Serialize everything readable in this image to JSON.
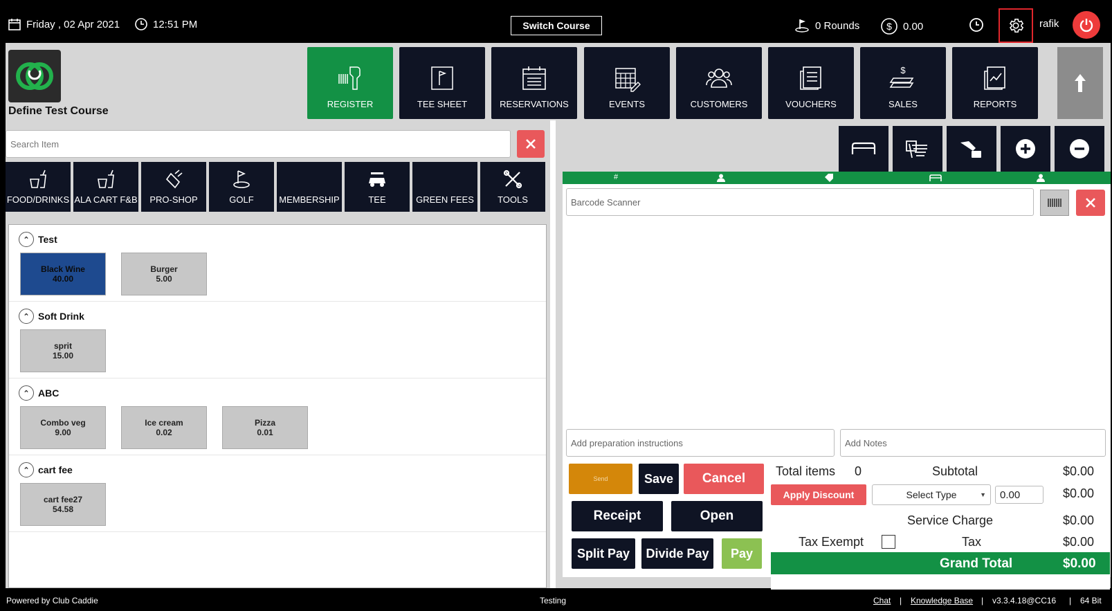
{
  "topbar": {
    "date": "Friday , 02 Apr 2021",
    "time": "12:51 PM",
    "switch_course": "Switch Course",
    "rounds": "0 Rounds",
    "balance": "0.00",
    "user": "rafik"
  },
  "brand": {
    "course_name": "Define Test Course"
  },
  "nav": [
    "REGISTER",
    "TEE SHEET",
    "RESERVATIONS",
    "EVENTS",
    "CUSTOMERS",
    "VOUCHERS",
    "SALES",
    "REPORTS"
  ],
  "search": {
    "placeholder": "Search Item"
  },
  "categories": [
    "FOOD/DRINKS",
    "ALA CART F&B",
    "PRO-SHOP",
    "GOLF",
    "MEMBERSHIP",
    "TEE",
    "GREEN FEES",
    "TOOLS"
  ],
  "groups": [
    {
      "name": "Test",
      "items": [
        {
          "name": "Black Wine",
          "price": "40.00"
        },
        {
          "name": "Burger",
          "price": "5.00"
        }
      ]
    },
    {
      "name": "Soft Drink",
      "items": [
        {
          "name": "sprit",
          "price": "15.00"
        }
      ]
    },
    {
      "name": "ABC",
      "items": [
        {
          "name": "Combo veg",
          "price": "9.00"
        },
        {
          "name": "Ice cream",
          "price": "0.02"
        },
        {
          "name": "Pizza",
          "price": "0.01"
        }
      ]
    },
    {
      "name": "cart fee",
      "items": [
        {
          "name": "cart fee27",
          "price": "54.58"
        }
      ]
    }
  ],
  "cart": {
    "barcode_placeholder": "Barcode Scanner",
    "prep_placeholder": "Add preparation instructions",
    "notes_placeholder": "Add Notes"
  },
  "actions": {
    "send": "Send",
    "save": "Save",
    "cancel": "Cancel",
    "receipt": "Receipt",
    "open": "Open",
    "split_pay": "Split Pay",
    "divide_pay": "Divide Pay",
    "pay": "Pay"
  },
  "totals": {
    "total_items_label": "Total items",
    "total_items": "0",
    "subtotal_label": "Subtotal",
    "subtotal": "$0.00",
    "apply_discount": "Apply Discount",
    "select_type": "Select Type",
    "discount_value": "0.00",
    "discount_amount": "$0.00",
    "service_charge_label": "Service Charge",
    "service_charge": "$0.00",
    "tax_exempt_label": "Tax Exempt",
    "tax_label": "Tax",
    "tax": "$0.00",
    "grand_total_label": "Grand Total",
    "grand_total": "$0.00"
  },
  "footer": {
    "powered": "Powered by Club Caddie",
    "env": "Testing",
    "chat": "Chat",
    "kb": "Knowledge Base",
    "version": "v3.3.4.18@CC16",
    "bits": "64 Bit"
  },
  "colors": {
    "accent_green": "#139145",
    "dark_button": "#0f1424",
    "danger_red": "#e9585b",
    "send_orange": "#d4870a",
    "pay_green": "#8cc152"
  }
}
